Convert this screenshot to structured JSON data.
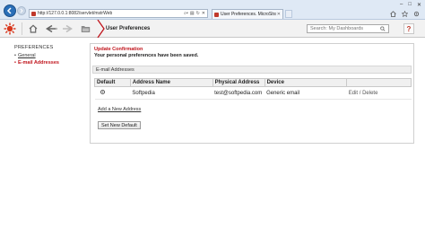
{
  "browser": {
    "url_host": "http://127.0.0.1",
    "url_path": ":8082/servlet/mstrWeb",
    "tab_title": "User Preferences. MicroStra...",
    "window_controls": [
      "–",
      "□",
      "✕"
    ],
    "right_icons": [
      "home-icon",
      "star-icon",
      "gear-icon"
    ]
  },
  "toolbar": {
    "breadcrumb": "User Preferences",
    "search_placeholder": "Search: My Dashboards",
    "help_label": "?"
  },
  "sidebar": {
    "heading": "PREFERENCES",
    "items": [
      {
        "label": "General",
        "active": false
      },
      {
        "label": "E-mail Addresses",
        "active": true
      }
    ]
  },
  "main": {
    "confirm_title": "Update Confirmation",
    "confirm_message": "Your personal preferences have been saved.",
    "section_title": "E-mail Addresses",
    "columns": [
      "Default",
      "Address Name",
      "Physical Address",
      "Device",
      ""
    ],
    "rows": [
      {
        "name": "Softpedia",
        "address": "test@softpedia.com",
        "device": "Generic email",
        "edit": "Edit",
        "sep": "/",
        "delete": "Delete"
      }
    ],
    "add_link": "Add a New Address",
    "set_default_button": "Set New Default"
  },
  "colors": {
    "accent_red": "#c0141c",
    "chrome_blue": "#2a6fb8"
  }
}
